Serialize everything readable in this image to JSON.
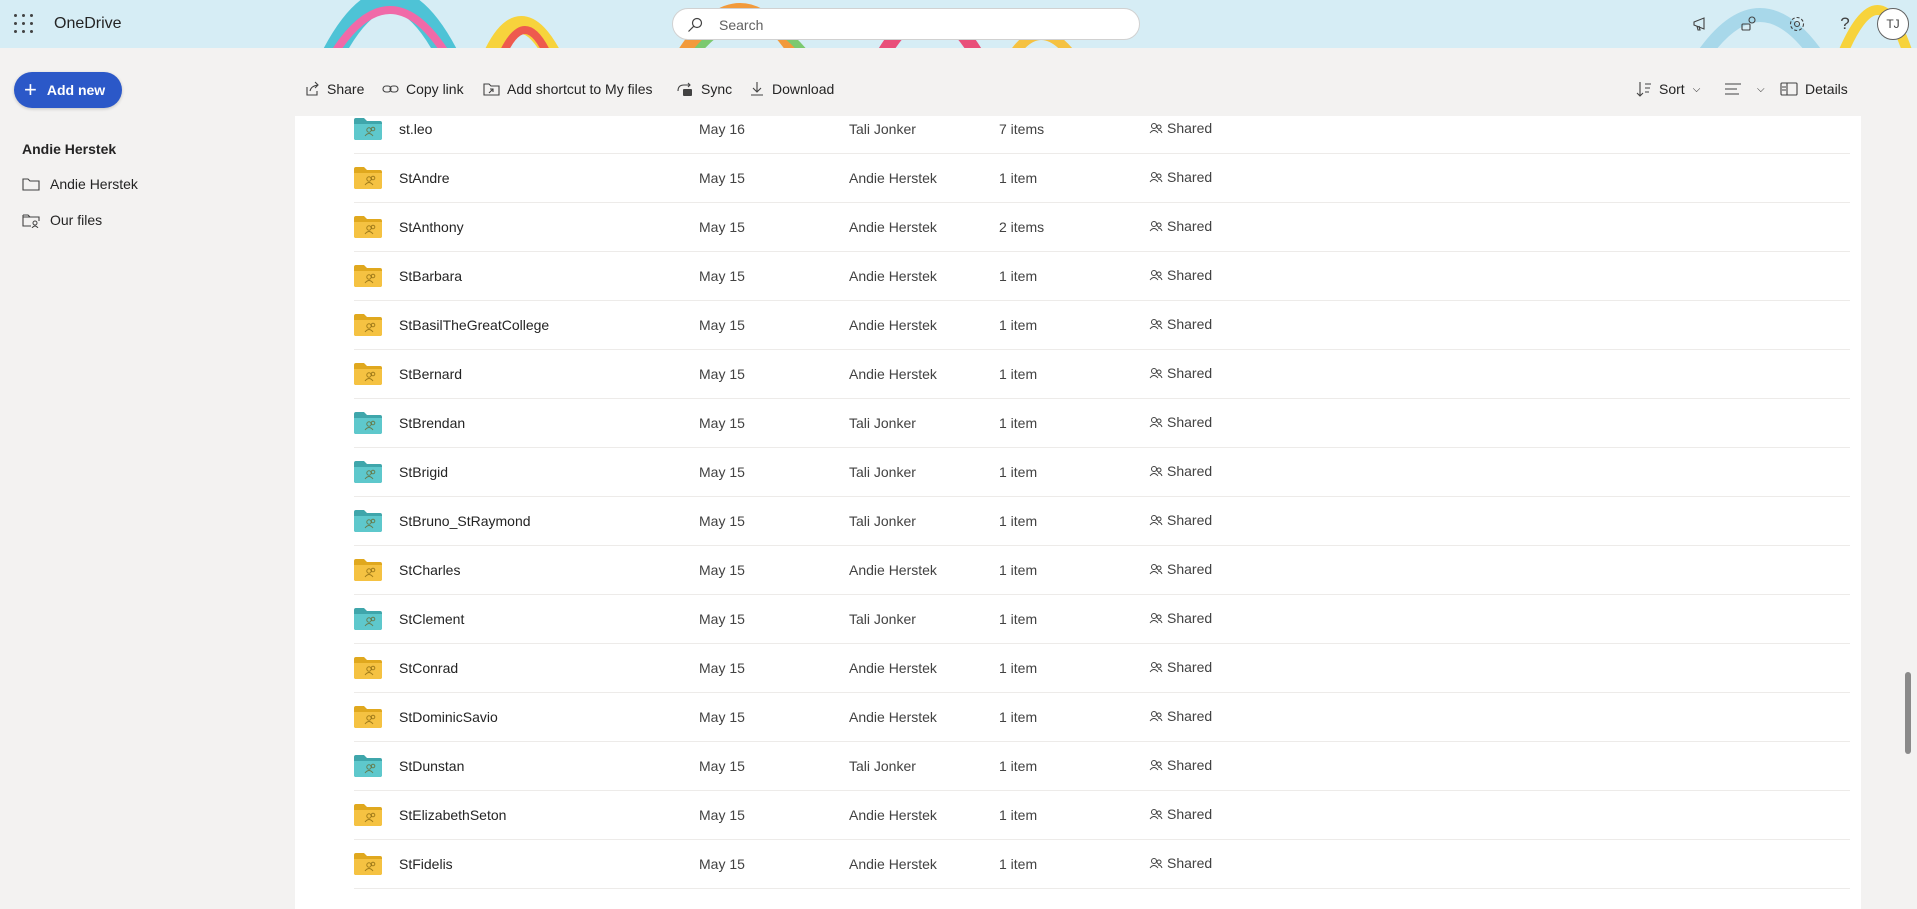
{
  "app": {
    "name": "OneDrive"
  },
  "search": {
    "placeholder": "Search"
  },
  "user": {
    "initials": "TJ"
  },
  "sidebar": {
    "add_new_label": "Add new",
    "heading": "Andie Herstek",
    "items": [
      {
        "label": "Andie Herstek",
        "icon": "folder-icon"
      },
      {
        "label": "Our files",
        "icon": "shared-folder-icon"
      }
    ]
  },
  "toolbar": {
    "share": "Share",
    "copy_link": "Copy link",
    "add_shortcut": "Add shortcut to My files",
    "sync": "Sync",
    "download": "Download",
    "sort": "Sort",
    "details": "Details"
  },
  "colors": {
    "accent": "#2b58c8",
    "folder_yellow": "#f5c242",
    "folder_teal": "#5ec8cc"
  },
  "files": [
    {
      "name": "st.leo",
      "modified": "May 16",
      "owner": "Tali Jonker",
      "size": "7 items",
      "sharing": "Shared",
      "color": "teal"
    },
    {
      "name": "StAndre",
      "modified": "May 15",
      "owner": "Andie Herstek",
      "size": "1 item",
      "sharing": "Shared",
      "color": "yellow"
    },
    {
      "name": "StAnthony",
      "modified": "May 15",
      "owner": "Andie Herstek",
      "size": "2 items",
      "sharing": "Shared",
      "color": "yellow"
    },
    {
      "name": "StBarbara",
      "modified": "May 15",
      "owner": "Andie Herstek",
      "size": "1 item",
      "sharing": "Shared",
      "color": "yellow"
    },
    {
      "name": "StBasilTheGreatCollege",
      "modified": "May 15",
      "owner": "Andie Herstek",
      "size": "1 item",
      "sharing": "Shared",
      "color": "yellow"
    },
    {
      "name": "StBernard",
      "modified": "May 15",
      "owner": "Andie Herstek",
      "size": "1 item",
      "sharing": "Shared",
      "color": "yellow"
    },
    {
      "name": "StBrendan",
      "modified": "May 15",
      "owner": "Tali Jonker",
      "size": "1 item",
      "sharing": "Shared",
      "color": "teal"
    },
    {
      "name": "StBrigid",
      "modified": "May 15",
      "owner": "Tali Jonker",
      "size": "1 item",
      "sharing": "Shared",
      "color": "teal"
    },
    {
      "name": "StBruno_StRaymond",
      "modified": "May 15",
      "owner": "Tali Jonker",
      "size": "1 item",
      "sharing": "Shared",
      "color": "teal"
    },
    {
      "name": "StCharles",
      "modified": "May 15",
      "owner": "Andie Herstek",
      "size": "1 item",
      "sharing": "Shared",
      "color": "yellow"
    },
    {
      "name": "StClement",
      "modified": "May 15",
      "owner": "Tali Jonker",
      "size": "1 item",
      "sharing": "Shared",
      "color": "teal"
    },
    {
      "name": "StConrad",
      "modified": "May 15",
      "owner": "Andie Herstek",
      "size": "1 item",
      "sharing": "Shared",
      "color": "yellow"
    },
    {
      "name": "StDominicSavio",
      "modified": "May 15",
      "owner": "Andie Herstek",
      "size": "1 item",
      "sharing": "Shared",
      "color": "yellow"
    },
    {
      "name": "StDunstan",
      "modified": "May 15",
      "owner": "Tali Jonker",
      "size": "1 item",
      "sharing": "Shared",
      "color": "teal"
    },
    {
      "name": "StElizabethSeton",
      "modified": "May 15",
      "owner": "Andie Herstek",
      "size": "1 item",
      "sharing": "Shared",
      "color": "yellow"
    },
    {
      "name": "StFidelis",
      "modified": "May 15",
      "owner": "Andie Herstek",
      "size": "1 item",
      "sharing": "Shared",
      "color": "yellow"
    }
  ]
}
